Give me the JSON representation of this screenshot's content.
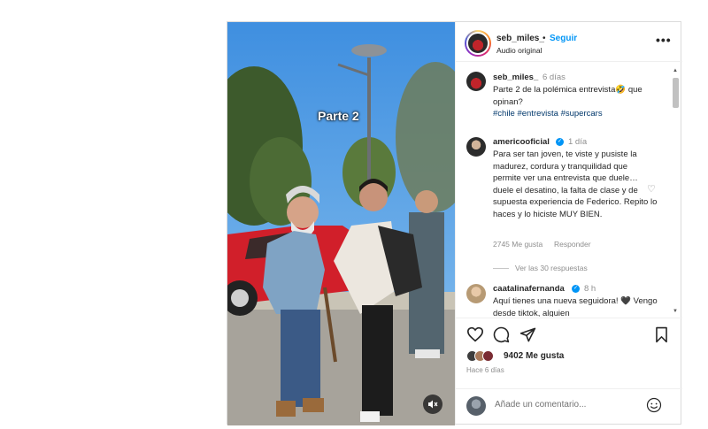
{
  "post": {
    "overlay_text": "Parte 2",
    "mute_icon": "speaker-muted-icon"
  },
  "header": {
    "username": "seb_miles_",
    "separator": "•",
    "follow_label": "Seguir",
    "audio": "Audio original",
    "more_icon": "more-horizontal-icon"
  },
  "caption": {
    "username": "seb_miles_",
    "time": "6 días",
    "text": "Parte 2 de la polémica entrevista🤣 que opinan?",
    "hashtags": "#chile #entrevista #supercars"
  },
  "comments": [
    {
      "username": "americooficial",
      "verified": true,
      "time": "1 día",
      "text": "Para ser tan joven, te viste y pusiste la madurez, cordura y tranquilidad que permite ver una entrevista que duele… duele el desatino, la falta de clase y de supuesta experiencia de Federico. Repito lo haces y lo hiciste MUY BIEN.",
      "likes": "2745 Me gusta",
      "reply_label": "Responder",
      "view_replies": "Ver las 30 respuestas"
    },
    {
      "username": "caatalinafernanda",
      "verified": true,
      "time": "8 h",
      "text": "Aquí tienes una nueva seguidora! 🖤 Vengo desde tiktok, alguien"
    }
  ],
  "actions": {
    "like_icon": "heart-icon",
    "comment_icon": "comment-icon",
    "share_icon": "share-icon",
    "save_icon": "bookmark-icon",
    "likes_count": "9402 Me gusta",
    "date": "Hace 6 días"
  },
  "add_comment": {
    "placeholder": "Añade un comentario...",
    "emoji_icon": "emoji-icon"
  },
  "colors": {
    "link_blue": "#0095f6",
    "hashtag": "#00376b",
    "muted_text": "#8e8e8e",
    "border": "#dbdbdb"
  }
}
